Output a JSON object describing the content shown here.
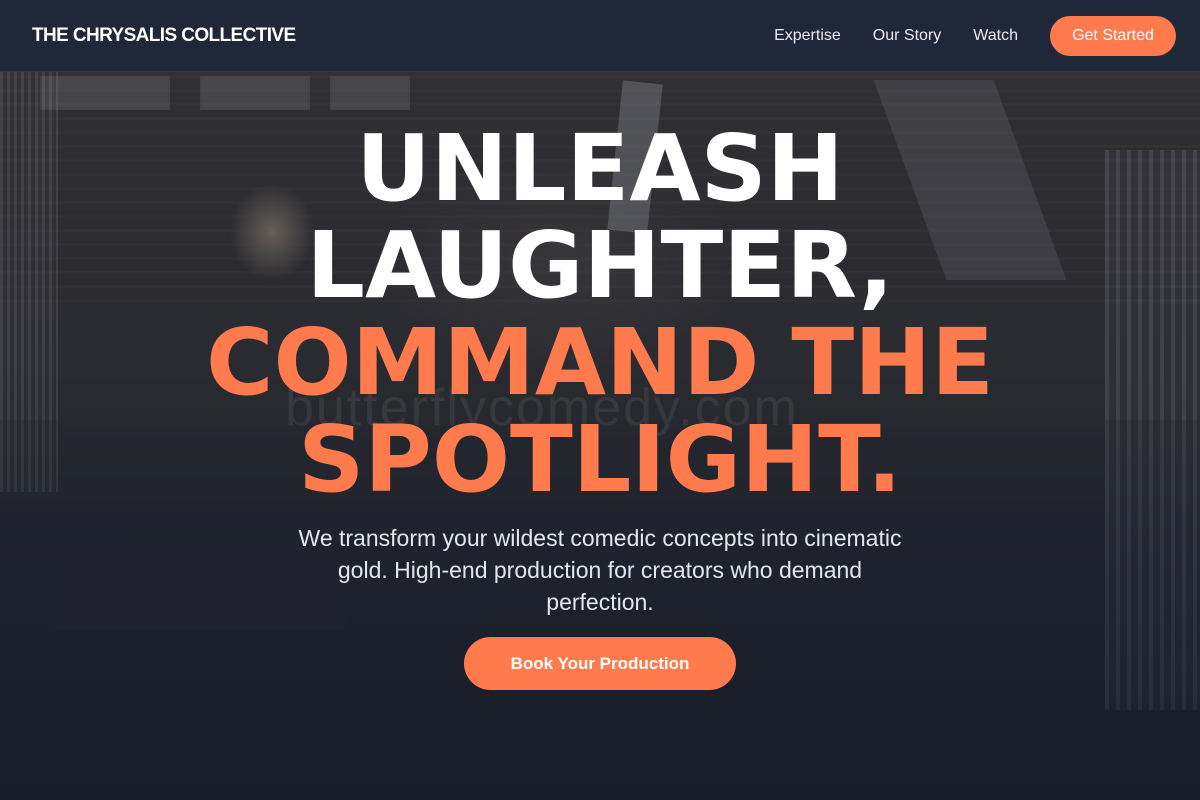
{
  "navbar": {
    "brand": "THE CHRYSALIS COLLECTIVE",
    "links": [
      {
        "label": "Expertise"
      },
      {
        "label": "Our Story"
      },
      {
        "label": "Watch"
      }
    ],
    "cta_label": "Get Started"
  },
  "hero": {
    "headline_lines": [
      "UNLEASH",
      "LAUGHTER,",
      "COMMAND THE",
      "SPOTLIGHT."
    ],
    "subtitle": "We transform your wildest comedic concepts into cinematic gold. High-end production for creators who demand perfection.",
    "cta_label": "Book Your Production",
    "watermark": "butterflycomedy.com"
  },
  "colors": {
    "accent": "#ff7a4c",
    "navbar_bg": "#1f2838",
    "text_light": "#ffffff"
  }
}
